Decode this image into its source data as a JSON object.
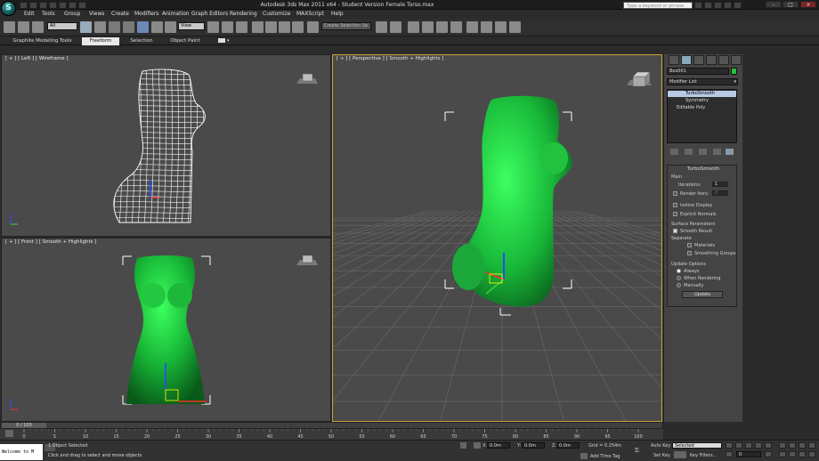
{
  "app": {
    "title": "Autodesk 3ds Max  2011 x64  - Student Version   Female Torso.max",
    "search_placeholder": "Type a keyword or phrase",
    "logo": "3ds-max-logo-icon"
  },
  "menu": [
    "Edit",
    "Tools",
    "Group",
    "Views",
    "Create",
    "Modifiers",
    "Animation",
    "Graph Editors",
    "Rendering",
    "Customize",
    "MAXScript",
    "Help"
  ],
  "toolbar": {
    "filter": "All",
    "ref_coord": "View",
    "named_sel": "Create Selection Se"
  },
  "ribbon": {
    "tabs": [
      "Graphite Modeling Tools",
      "Freeform",
      "Selection",
      "Object Paint"
    ],
    "active": "Freeform"
  },
  "viewports": {
    "left": "[ + ] [ Left ] [ Wireframe ]",
    "perspective": "[ + ] [ Perspective ] [ Smooth + Highlights ]",
    "front": "[ + ] [ Front ] [ Smooth + Highlights ]"
  },
  "command_panel": {
    "object_name": "Box001",
    "object_color": "#21c33b",
    "modifier_list": "Modifier List",
    "stack": [
      "TurboSmooth",
      "Symmetry",
      "Editable Poly"
    ],
    "rollout_title": "TurboSmooth",
    "main": {
      "label": "Main",
      "iterations_label": "Iterations:",
      "iterations": "1",
      "render_iters_label": "Render Iters:",
      "render_iters": "0",
      "isoline": "Isoline Display",
      "explicit": "Explicit Normals"
    },
    "surface": {
      "label": "Surface Parameters",
      "smooth_result": "Smooth Result",
      "separate": "Separate",
      "materials": "Materials",
      "smoothing_groups": "Smoothing Groups"
    },
    "update": {
      "label": "Update Options",
      "always": "Always",
      "when_rendering": "When Rendering",
      "manually": "Manually",
      "update_button": "Update"
    }
  },
  "timeline": {
    "frame": "0 / 100",
    "ticks": [
      "0",
      "5",
      "10",
      "15",
      "20",
      "25",
      "30",
      "35",
      "40",
      "45",
      "50",
      "55",
      "60",
      "65",
      "70",
      "75",
      "80",
      "85",
      "90",
      "95",
      "100"
    ]
  },
  "status": {
    "maxscript": "Welcome to M",
    "selected": "1 Object Selected",
    "prompt": "Click and drag to select and move objects",
    "x_label": "X:",
    "x": "0.0m",
    "y_label": "Y:",
    "y": "0.0m",
    "z_label": "Z:",
    "z": "0.0m",
    "grid": "Grid = 0.254m",
    "add_time_tag": "Add Time Tag",
    "auto_key": "Auto Key",
    "set_key": "Set Key",
    "key_mode": "Selected",
    "key_filters": "Key Filters...",
    "frame_field": "0"
  }
}
